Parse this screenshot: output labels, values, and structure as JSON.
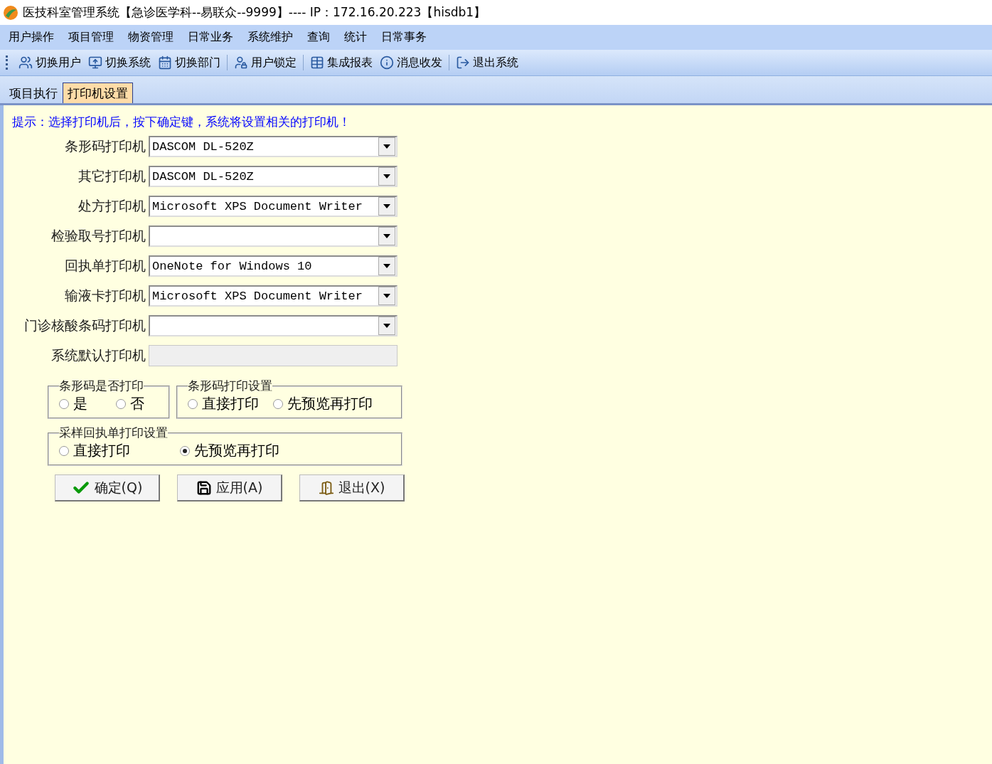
{
  "window": {
    "title": "医技科室管理系统【急诊医学科--易联众--9999】---- IP：172.16.20.223【hisdb1】"
  },
  "menu": [
    "用户操作",
    "项目管理",
    "物资管理",
    "日常业务",
    "系统维护",
    "查询",
    "统计",
    "日常事务"
  ],
  "toolbar": [
    {
      "label": "切换用户"
    },
    {
      "label": "切换系统"
    },
    {
      "label": "切换部门"
    },
    {
      "label": "用户锁定"
    },
    {
      "label": "集成报表"
    },
    {
      "label": "消息收发"
    },
    {
      "label": "退出系统"
    }
  ],
  "tabs": [
    {
      "label": "项目执行",
      "selected": false
    },
    {
      "label": "打印机设置",
      "selected": true
    }
  ],
  "hint": "提示：选择打印机后，按下确定键，系统将设置相关的打印机！",
  "printers": [
    {
      "label": "条形码打印机",
      "value": "DASCOM DL-520Z",
      "kind": "combo"
    },
    {
      "label": "其它打印机",
      "value": "DASCOM DL-520Z",
      "kind": "combo"
    },
    {
      "label": "处方打印机",
      "value": "Microsoft XPS Document Writer",
      "kind": "combo"
    },
    {
      "label": "检验取号打印机",
      "kind": "combo"
    },
    {
      "label": "回执单打印机",
      "value": "OneNote for Windows 10",
      "kind": "combo"
    },
    {
      "label": "输液卡打印机",
      "value": "Microsoft XPS Document Writer",
      "kind": "combo"
    },
    {
      "label": "门诊核酸条码打印机",
      "kind": "combo"
    },
    {
      "label": "系统默认打印机",
      "kind": "readonly"
    }
  ],
  "groups": [
    {
      "title": "条形码是否打印",
      "options": [
        {
          "label": "是",
          "selected": false
        },
        {
          "label": "否",
          "selected": false
        }
      ]
    },
    {
      "title": "条形码打印设置",
      "options": [
        {
          "label": "直接打印",
          "selected": false
        },
        {
          "label": "先预览再打印",
          "selected": false
        }
      ]
    },
    {
      "title": "采样回执单打印设置",
      "options": [
        {
          "label": "直接打印",
          "selected": false
        },
        {
          "label": "先预览再打印",
          "selected": true
        }
      ]
    }
  ],
  "buttons": [
    {
      "label": "确定(Q)",
      "kind": "ok"
    },
    {
      "label": "应用(A)",
      "kind": "apply"
    },
    {
      "label": "退出(X)",
      "kind": "exit"
    }
  ]
}
